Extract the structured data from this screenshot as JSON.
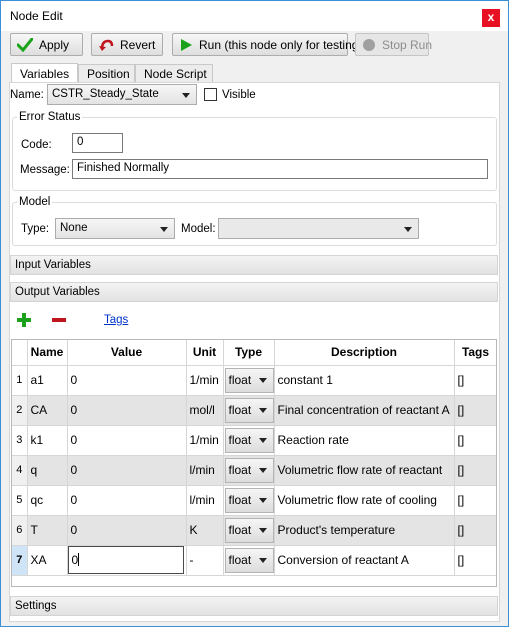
{
  "window": {
    "title": "Node Edit",
    "close_glyph": "x"
  },
  "toolbar": {
    "apply_label": "Apply",
    "revert_label": "Revert",
    "run_label": "Run (this node only for testing)",
    "stop_label": "Stop Run"
  },
  "tabs": [
    {
      "label": "Variables",
      "active": true
    },
    {
      "label": "Position",
      "active": false
    },
    {
      "label": "Node Script",
      "active": false
    }
  ],
  "name_row": {
    "label": "Name:",
    "value": "CSTR_Steady_State",
    "visible_label": "Visible",
    "visible_checked": false
  },
  "error_status": {
    "title": "Error Status",
    "code_label": "Code:",
    "code_value": "0",
    "message_label": "Message:",
    "message_value": "Finished Normally"
  },
  "model": {
    "title": "Model",
    "type_label": "Type:",
    "type_value": "None",
    "model_label": "Model:",
    "model_value": ""
  },
  "sections": {
    "input_variables": "Input Variables",
    "output_variables": "Output Variables",
    "settings": "Settings"
  },
  "output_toolbar": {
    "add_icon": "plus-icon",
    "remove_icon": "minus-icon",
    "tags_link": "Tags"
  },
  "table": {
    "headers": [
      "",
      "Name",
      "Value",
      "Unit",
      "Type",
      "Description",
      "Tags"
    ],
    "rows": [
      {
        "num": "1",
        "name": "a1",
        "value": "0",
        "unit": "1/min",
        "type": "float",
        "description": "constant 1",
        "tags": "[]"
      },
      {
        "num": "2",
        "name": "CA",
        "value": "0",
        "unit": "mol/l",
        "type": "float",
        "description": "Final concentration of reactant A",
        "tags": "[]"
      },
      {
        "num": "3",
        "name": "k1",
        "value": "0",
        "unit": "1/min",
        "type": "float",
        "description": "Reaction rate",
        "tags": "[]"
      },
      {
        "num": "4",
        "name": "q",
        "value": "0",
        "unit": "l/min",
        "type": "float",
        "description": "Volumetric flow rate of reactant",
        "tags": "[]"
      },
      {
        "num": "5",
        "name": "qc",
        "value": "0",
        "unit": "l/min",
        "type": "float",
        "description": "Volumetric flow rate of cooling",
        "tags": "[]"
      },
      {
        "num": "6",
        "name": "T",
        "value": "0",
        "unit": "K",
        "type": "float",
        "description": "Product's temperature",
        "tags": "[]"
      },
      {
        "num": "7",
        "name": "XA",
        "value": "0",
        "unit": "-",
        "type": "float",
        "description": "Conversion of reactant A",
        "tags": "[]"
      }
    ],
    "selected_row": 7
  },
  "colors": {
    "accent_green": "#1aa31a",
    "remove_red": "#c0141e",
    "link_blue": "#0033cc",
    "close_red": "#e81123"
  }
}
